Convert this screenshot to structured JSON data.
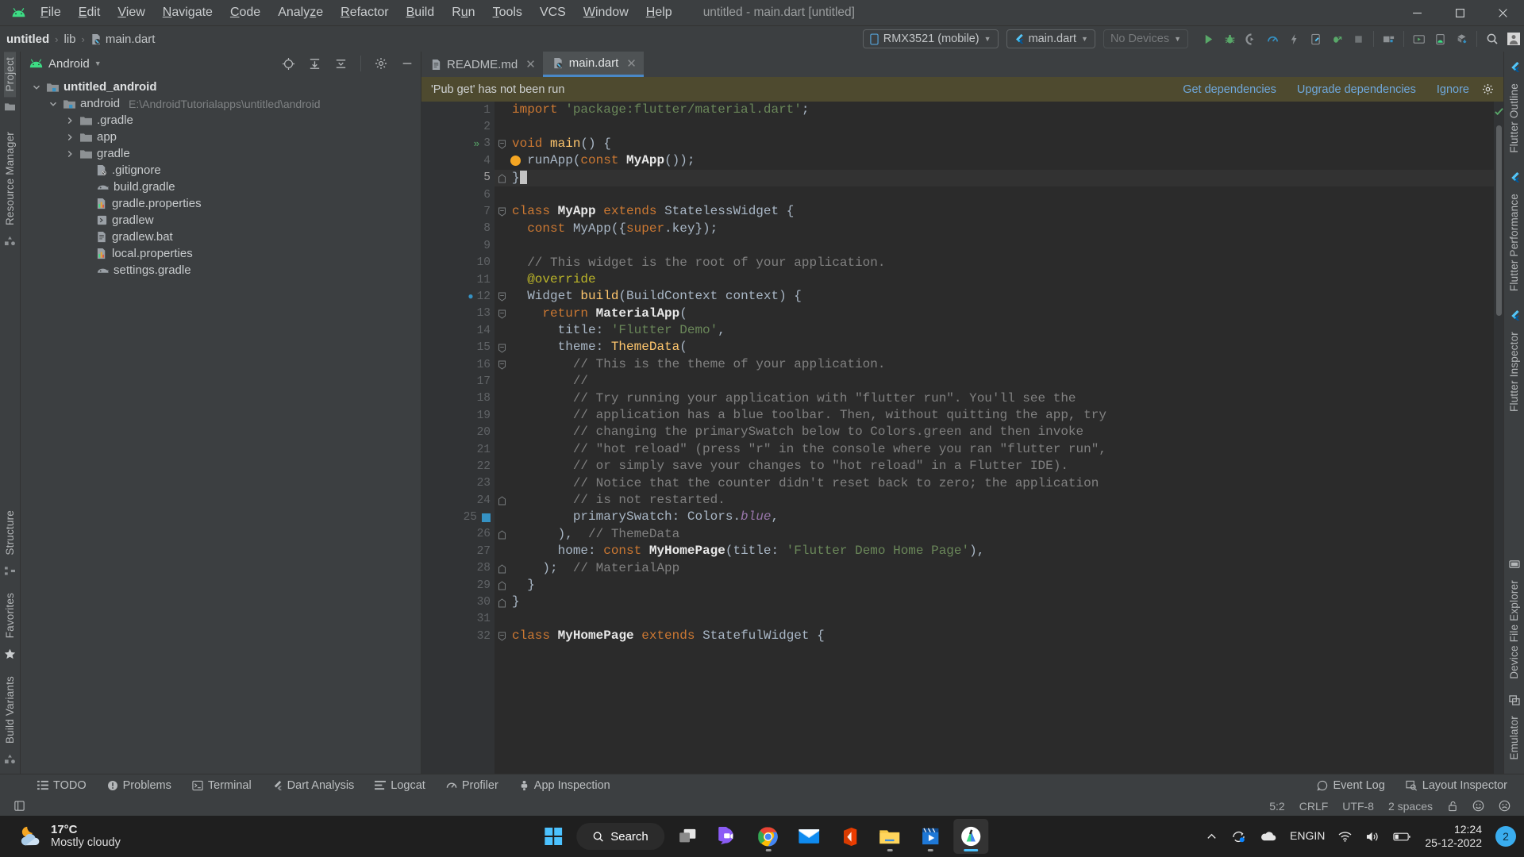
{
  "window": {
    "title": "untitled - main.dart [untitled]",
    "logo_icon": "android-logo-icon",
    "minimize_icon": "minimize-icon",
    "maximize_icon": "maximize-icon",
    "close_icon": "close-icon"
  },
  "menubar": {
    "items": [
      {
        "label": "File",
        "mnemonic": "F"
      },
      {
        "label": "Edit",
        "mnemonic": "E"
      },
      {
        "label": "View",
        "mnemonic": "V"
      },
      {
        "label": "Navigate",
        "mnemonic": "N"
      },
      {
        "label": "Code",
        "mnemonic": "C"
      },
      {
        "label": "Analyze",
        "mnemonic": "z"
      },
      {
        "label": "Refactor",
        "mnemonic": "R"
      },
      {
        "label": "Build",
        "mnemonic": "B"
      },
      {
        "label": "Run",
        "mnemonic": "u"
      },
      {
        "label": "Tools",
        "mnemonic": "T"
      },
      {
        "label": "VCS",
        "mnemonic": ""
      },
      {
        "label": "Window",
        "mnemonic": "W"
      },
      {
        "label": "Help",
        "mnemonic": "H"
      }
    ]
  },
  "navbar": {
    "breadcrumbs": [
      {
        "label": "untitled",
        "icon": ""
      },
      {
        "label": "lib",
        "icon": ""
      },
      {
        "label": "main.dart",
        "icon": "dart-file-icon"
      }
    ],
    "separator": "›",
    "device_selector": {
      "label": "RMX3521 (mobile)",
      "icon": "phone-icon"
    },
    "run_config": {
      "label": "main.dart",
      "icon": "flutter-icon"
    },
    "devices_selector": {
      "label": "No Devices",
      "icon": ""
    },
    "actions": [
      {
        "name": "run-button",
        "icon": "play-icon"
      },
      {
        "name": "debug-button",
        "icon": "bug-icon"
      },
      {
        "name": "run-with-coverage-button",
        "icon": "coverage-icon"
      },
      {
        "name": "profile-button",
        "icon": "gauge-icon"
      },
      {
        "name": "hot-reload-button",
        "icon": "lightning-icon"
      },
      {
        "name": "open-devtools-button",
        "icon": "device-flutter-icon"
      },
      {
        "name": "attach-debugger-button",
        "icon": "attach-bug-icon"
      },
      {
        "name": "stop-button",
        "icon": "stop-icon"
      },
      {
        "name": "sdk-manager-button",
        "icon": "sdk-manager-icon"
      },
      {
        "name": "avd-manager-button",
        "icon": "avd-manager-icon"
      },
      {
        "name": "device-manager-button",
        "icon": "device-manager-icon"
      },
      {
        "name": "gradle-sync-button",
        "icon": "sync-gradle-icon"
      },
      {
        "name": "search-everywhere-button",
        "icon": "search-icon"
      },
      {
        "name": "account-button",
        "icon": "avatar-icon"
      }
    ]
  },
  "left_strip": {
    "top": [
      {
        "label": "Project",
        "selected": true,
        "icon": "project-icon"
      },
      {
        "label": "",
        "icon": "folder-icon"
      },
      {
        "label": "Resource Manager",
        "selected": false,
        "icon": ""
      },
      {
        "label": "",
        "icon": "build-variants-icon"
      }
    ],
    "bottom": [
      {
        "label": "Structure",
        "icon": "structure-icon"
      },
      {
        "label": "Favorites",
        "icon": "star-icon"
      },
      {
        "label": "Build Variants",
        "icon": "variants-icon"
      }
    ]
  },
  "right_strip": {
    "top": [
      {
        "label": "Flutter Outline",
        "icon": "flutter-icon"
      },
      {
        "label": "Flutter Performance",
        "icon": "flutter-icon"
      },
      {
        "label": "Flutter Inspector",
        "icon": "flutter-icon"
      }
    ],
    "bottom": [
      {
        "label": "Device File Explorer",
        "icon": "device-icon"
      },
      {
        "label": "Emulator",
        "icon": "emulator-icon"
      }
    ]
  },
  "project_panel": {
    "title": "Android",
    "title_icon": "android-head-icon",
    "caret_icon": "chevron-down-icon",
    "header_actions": [
      {
        "name": "select-opened-file-button",
        "icon": "crosshair-icon"
      },
      {
        "name": "expand-all-button",
        "icon": "expand-all-icon"
      },
      {
        "name": "collapse-all-button",
        "icon": "collapse-all-icon"
      },
      {
        "name": "settings-button",
        "icon": "gear-icon"
      },
      {
        "name": "hide-button",
        "icon": "minimize-icon"
      }
    ],
    "tree": [
      {
        "label": "untitled_android",
        "indent": 0,
        "arrow": "down",
        "icon": "module-icon",
        "bold": true,
        "path": ""
      },
      {
        "label": "android",
        "indent": 1,
        "arrow": "down",
        "icon": "module-icon",
        "bold": false,
        "path": "E:\\AndroidTutorialapps\\untitled\\android"
      },
      {
        "label": ".gradle",
        "indent": 2,
        "arrow": "right",
        "icon": "folder-icon",
        "bold": false,
        "path": ""
      },
      {
        "label": "app",
        "indent": 2,
        "arrow": "right",
        "icon": "folder-icon",
        "bold": false,
        "path": ""
      },
      {
        "label": "gradle",
        "indent": 2,
        "arrow": "right",
        "icon": "folder-icon",
        "bold": false,
        "path": ""
      },
      {
        "label": ".gitignore",
        "indent": 3,
        "arrow": "none",
        "icon": "gitignore-file-icon",
        "bold": false,
        "path": ""
      },
      {
        "label": "build.gradle",
        "indent": 3,
        "arrow": "none",
        "icon": "gradle-file-icon",
        "bold": false,
        "path": ""
      },
      {
        "label": "gradle.properties",
        "indent": 3,
        "arrow": "none",
        "icon": "properties-file-icon",
        "bold": false,
        "path": ""
      },
      {
        "label": "gradlew",
        "indent": 3,
        "arrow": "none",
        "icon": "script-file-icon",
        "bold": false,
        "path": ""
      },
      {
        "label": "gradlew.bat",
        "indent": 3,
        "arrow": "none",
        "icon": "text-file-icon",
        "bold": false,
        "path": ""
      },
      {
        "label": "local.properties",
        "indent": 3,
        "arrow": "none",
        "icon": "properties-file-icon",
        "bold": false,
        "path": ""
      },
      {
        "label": "settings.gradle",
        "indent": 3,
        "arrow": "none",
        "icon": "gradle-file-icon",
        "bold": false,
        "path": ""
      }
    ]
  },
  "editor": {
    "tabs": [
      {
        "label": "README.md",
        "icon": "markdown-file-icon",
        "active": false
      },
      {
        "label": "main.dart",
        "icon": "dart-file-icon",
        "active": true
      }
    ],
    "close_icon": "close-icon",
    "notice": {
      "message": "'Pub get' has not been run",
      "links": [
        "Get dependencies",
        "Upgrade dependencies",
        "Ignore"
      ],
      "settings_icon": "gear-icon"
    },
    "inspection_ok_icon": "checkmark-icon",
    "first_line": 1,
    "last_line": 32,
    "current_line": 5,
    "lines": [
      {
        "n": 1,
        "tokens": [
          {
            "t": "import",
            "c": "kw"
          },
          {
            "t": " ",
            "c": "pl"
          },
          {
            "t": "'package:flutter/material.dart'",
            "c": "str"
          },
          {
            "t": ";",
            "c": "pl"
          }
        ]
      },
      {
        "n": 2,
        "tokens": []
      },
      {
        "n": 3,
        "tokens": [
          {
            "t": "void",
            "c": "kw"
          },
          {
            "t": " ",
            "c": "pl"
          },
          {
            "t": "main",
            "c": "fn"
          },
          {
            "t": "() {",
            "c": "pl"
          }
        ]
      },
      {
        "n": 4,
        "tokens": [
          {
            "t": "  runApp(",
            "c": "pl"
          },
          {
            "t": "const",
            "c": "kw"
          },
          {
            "t": " ",
            "c": "pl"
          },
          {
            "t": "MyApp",
            "c": "cls"
          },
          {
            "t": "());",
            "c": "pl"
          }
        ]
      },
      {
        "n": 5,
        "tokens": [
          {
            "t": "}",
            "c": "pl"
          }
        ]
      },
      {
        "n": 6,
        "tokens": []
      },
      {
        "n": 7,
        "tokens": [
          {
            "t": "class",
            "c": "kw"
          },
          {
            "t": " ",
            "c": "pl"
          },
          {
            "t": "MyApp",
            "c": "cls"
          },
          {
            "t": " ",
            "c": "pl"
          },
          {
            "t": "extends",
            "c": "kw"
          },
          {
            "t": " StatelessWidget {",
            "c": "pl"
          }
        ]
      },
      {
        "n": 8,
        "tokens": [
          {
            "t": "  ",
            "c": "pl"
          },
          {
            "t": "const",
            "c": "kw"
          },
          {
            "t": " MyApp({",
            "c": "pl"
          },
          {
            "t": "super",
            "c": "kw"
          },
          {
            "t": ".key});",
            "c": "pl"
          }
        ]
      },
      {
        "n": 9,
        "tokens": []
      },
      {
        "n": 10,
        "tokens": [
          {
            "t": "  // This widget is the root of your application.",
            "c": "cmt"
          }
        ]
      },
      {
        "n": 11,
        "tokens": [
          {
            "t": "  @override",
            "c": "ann"
          }
        ]
      },
      {
        "n": 12,
        "tokens": [
          {
            "t": "  Widget ",
            "c": "pl"
          },
          {
            "t": "build",
            "c": "fn"
          },
          {
            "t": "(BuildContext context) {",
            "c": "pl"
          }
        ]
      },
      {
        "n": 13,
        "tokens": [
          {
            "t": "    ",
            "c": "pl"
          },
          {
            "t": "return",
            "c": "kw"
          },
          {
            "t": " ",
            "c": "pl"
          },
          {
            "t": "MaterialApp",
            "c": "cls"
          },
          {
            "t": "(",
            "c": "pl"
          }
        ]
      },
      {
        "n": 14,
        "tokens": [
          {
            "t": "      title: ",
            "c": "pl"
          },
          {
            "t": "'Flutter Demo'",
            "c": "str"
          },
          {
            "t": ",",
            "c": "pl"
          }
        ]
      },
      {
        "n": 15,
        "tokens": [
          {
            "t": "      theme: ",
            "c": "pl"
          },
          {
            "t": "ThemeData",
            "c": "fn"
          },
          {
            "t": "(",
            "c": "pl"
          }
        ]
      },
      {
        "n": 16,
        "tokens": [
          {
            "t": "        // This is the theme of your application.",
            "c": "cmt"
          }
        ]
      },
      {
        "n": 17,
        "tokens": [
          {
            "t": "        //",
            "c": "cmt"
          }
        ]
      },
      {
        "n": 18,
        "tokens": [
          {
            "t": "        // Try running your application with \"flutter run\". You'll see the",
            "c": "cmt"
          }
        ]
      },
      {
        "n": 19,
        "tokens": [
          {
            "t": "        // application has a blue toolbar. Then, without quitting the app, try",
            "c": "cmt"
          }
        ]
      },
      {
        "n": 20,
        "tokens": [
          {
            "t": "        // changing the primarySwatch below to Colors.green and then invoke",
            "c": "cmt"
          }
        ]
      },
      {
        "n": 21,
        "tokens": [
          {
            "t": "        // \"hot reload\" (press \"r\" in the console where you ran \"flutter run\",",
            "c": "cmt"
          }
        ]
      },
      {
        "n": 22,
        "tokens": [
          {
            "t": "        // or simply save your changes to \"hot reload\" in a Flutter IDE).",
            "c": "cmt"
          }
        ]
      },
      {
        "n": 23,
        "tokens": [
          {
            "t": "        // Notice that the counter didn't reset back to zero; the application",
            "c": "cmt"
          }
        ]
      },
      {
        "n": 24,
        "tokens": [
          {
            "t": "        // is not restarted.",
            "c": "cmt"
          }
        ]
      },
      {
        "n": 25,
        "tokens": [
          {
            "t": "        primarySwatch: Colors.",
            "c": "pl"
          },
          {
            "t": "blue",
            "c": "fld"
          },
          {
            "t": ",",
            "c": "pl"
          }
        ]
      },
      {
        "n": 26,
        "tokens": [
          {
            "t": "      ),",
            "c": "pl"
          },
          {
            "t": "  // ThemeData",
            "c": "cmt"
          }
        ]
      },
      {
        "n": 27,
        "tokens": [
          {
            "t": "      home: ",
            "c": "pl"
          },
          {
            "t": "const",
            "c": "kw"
          },
          {
            "t": " ",
            "c": "pl"
          },
          {
            "t": "MyHomePage",
            "c": "cls"
          },
          {
            "t": "(title: ",
            "c": "pl"
          },
          {
            "t": "'Flutter Demo Home Page'",
            "c": "str"
          },
          {
            "t": "),",
            "c": "pl"
          }
        ]
      },
      {
        "n": 28,
        "tokens": [
          {
            "t": "    );",
            "c": "pl"
          },
          {
            "t": "  // MaterialApp",
            "c": "cmt"
          }
        ]
      },
      {
        "n": 29,
        "tokens": [
          {
            "t": "  }",
            "c": "pl"
          }
        ]
      },
      {
        "n": 30,
        "tokens": [
          {
            "t": "}",
            "c": "pl"
          }
        ]
      },
      {
        "n": 31,
        "tokens": []
      },
      {
        "n": 32,
        "tokens": [
          {
            "t": "class",
            "c": "kw"
          },
          {
            "t": " ",
            "c": "pl"
          },
          {
            "t": "MyHomePage",
            "c": "cls"
          },
          {
            "t": " ",
            "c": "pl"
          },
          {
            "t": "extends",
            "c": "kw"
          },
          {
            "t": " StatefulWidget {",
            "c": "pl"
          }
        ]
      }
    ]
  },
  "tool_windows": [
    {
      "label": "TODO",
      "icon": "todo-icon"
    },
    {
      "label": "Problems",
      "icon": "problems-icon"
    },
    {
      "label": "Terminal",
      "icon": "terminal-icon"
    },
    {
      "label": "Dart Analysis",
      "icon": "dart-icon"
    },
    {
      "label": "Logcat",
      "icon": "logcat-icon"
    },
    {
      "label": "Profiler",
      "icon": "gauge-icon"
    },
    {
      "label": "App Inspection",
      "icon": "app-inspection-icon"
    }
  ],
  "tool_windows_right": [
    {
      "label": "Event Log",
      "icon": "event-log-icon"
    },
    {
      "label": "Layout Inspector",
      "icon": "layout-inspector-icon"
    }
  ],
  "status_bar": {
    "left_icon": "toggle-toolwindows-icon",
    "caret_position": "5:2",
    "line_separator": "CRLF",
    "encoding": "UTF-8",
    "indent": "2 spaces",
    "lock_icon": "unlock-icon",
    "happy_icon": "smiley-happy-icon",
    "sad_icon": "smiley-sad-icon"
  },
  "taskbar": {
    "weather": {
      "temp": "17°C",
      "desc": "Mostly cloudy",
      "icon": "moon-cloud-icon"
    },
    "start_icon": "windows-start-icon",
    "search": {
      "label": "Search",
      "icon": "search-icon"
    },
    "apps": [
      {
        "name": "task-view-icon",
        "running": false
      },
      {
        "name": "chat-teams-icon",
        "running": false
      },
      {
        "name": "google-chrome-icon",
        "running": true
      },
      {
        "name": "mail-icon",
        "running": false
      },
      {
        "name": "office-icon",
        "running": false
      },
      {
        "name": "file-explorer-icon",
        "running": true
      },
      {
        "name": "media-player-icon",
        "running": true
      },
      {
        "name": "android-studio-icon",
        "running": true,
        "active": true
      }
    ],
    "tray": {
      "chevron_icon": "show-hidden-icons-icon",
      "onedrive_sync_icon": "onedrive-sync-icon",
      "onedrive_icon": "onedrive-icon",
      "language": {
        "line1": "ENG",
        "line2": "IN"
      },
      "wifi_icon": "wifi-icon",
      "volume_icon": "volume-icon",
      "battery_icon": "battery-icon",
      "time": "12:24",
      "date": "25-12-2022",
      "notification_count": "2"
    }
  },
  "colors": {
    "accent_blue": "#4a88c7",
    "notice_bg": "#4e4a2f",
    "editor_bg": "#2b2b2b",
    "chrome_bg": "#3c3f41",
    "taskbar_bg": "#1f1f1f",
    "keyword": "#cc7832",
    "string": "#6a8759",
    "comment": "#808080",
    "function": "#ffc66d",
    "annotation": "#bbb529",
    "field": "#9876aa"
  }
}
